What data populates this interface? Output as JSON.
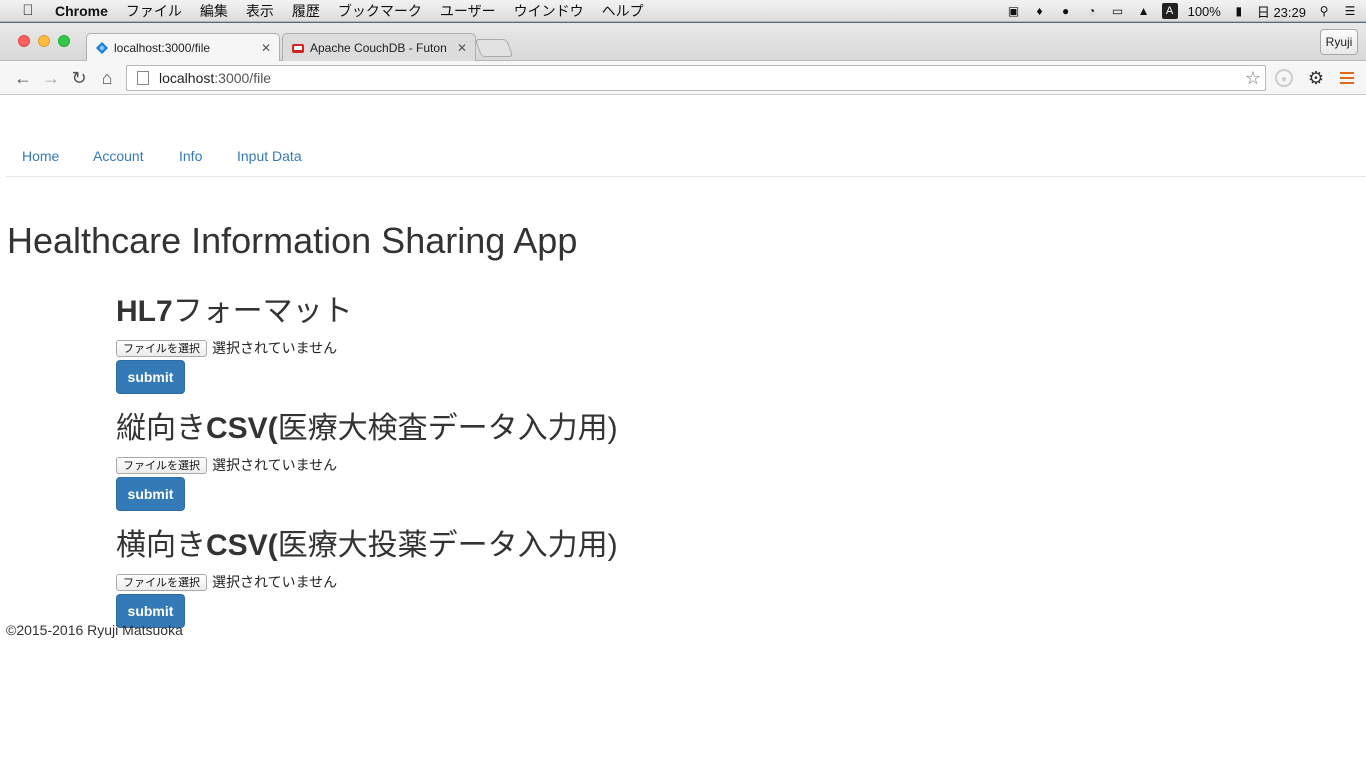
{
  "os_menubar": {
    "app_name": "Chrome",
    "menus": [
      "ファイル",
      "編集",
      "表示",
      "履歴",
      "ブックマーク",
      "ユーザー",
      "ウインドウ",
      "ヘルプ"
    ],
    "battery": "100%",
    "clock": "日 23:29",
    "input_mode": "A"
  },
  "browser": {
    "tabs": [
      {
        "title": "localhost:3000/file",
        "active": true
      },
      {
        "title": "Apache CouchDB - Futon",
        "active": false
      }
    ],
    "profile_name": "Ryuji",
    "url_host": "localhost",
    "url_path": ":3000/file"
  },
  "page": {
    "nav": [
      "Home",
      "Account",
      "Info",
      "Input Data"
    ],
    "title": "Healthcare Information Sharing App",
    "sections": [
      {
        "title_bold": "HL7",
        "title_rest": "フォーマット",
        "title_bold_suffix": "",
        "title_tail": ""
      },
      {
        "title_prefix": "縦向き",
        "title_bold": "CSV(",
        "title_rest": "医療大検査データ入力用)"
      },
      {
        "title_prefix": "横向き",
        "title_bold": "CSV(",
        "title_rest": "医療大投薬データ入力用)"
      }
    ],
    "file_button_label": "ファイルを選択",
    "no_file_text": "選択されていません",
    "submit_label": "submit",
    "footer": "©2015-2016 Ryuji Matsuoka"
  },
  "colors": {
    "link": "#337ab7",
    "button": "#337ab7",
    "text": "#333333"
  }
}
